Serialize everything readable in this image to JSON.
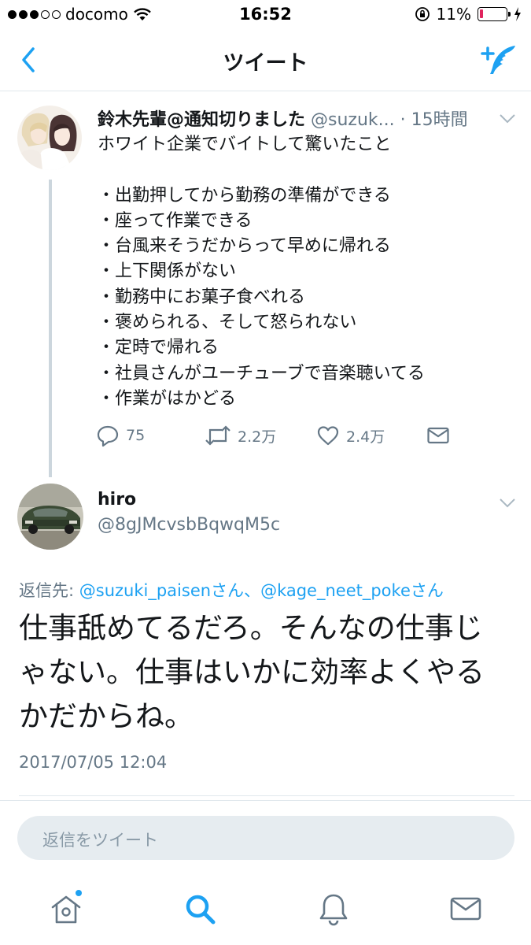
{
  "status_bar": {
    "carrier": "docomo",
    "time": "16:52",
    "battery": "11%",
    "battery_level": 0.11
  },
  "nav": {
    "title": "ツイート"
  },
  "tweet": {
    "display_name": "鈴木先輩@通知切りました",
    "handle": "@suzuk...",
    "time": "· 15時間",
    "lines": [
      "ホワイト企業でバイトして驚いたこと",
      "",
      "・出勤押してから勤務の準備ができる",
      "・座って作業できる",
      "・台風来そうだからって早めに帰れる",
      "・上下関係がない",
      "・勤務中にお菓子食べれる",
      "・褒められる、そして怒られない",
      "・定時で帰れる",
      "・社員さんがユーチューブで音楽聴いてる",
      "・作業がはかどる"
    ],
    "reply_count": "75",
    "retweet_count": "2.2万",
    "like_count": "2.4万"
  },
  "reply": {
    "display_name": "hiro",
    "handle": "@8gJMcvsbBqwqM5c",
    "reply_to_label": "返信先: ",
    "mention_1": "@suzuki_paisenさん",
    "separator": "、",
    "mention_2": "@kage_neet_pokeさん",
    "text_lines": [
      "仕事舐めてるだろ。そんなの仕事じ",
      "ゃない。仕事はいかに効率よくやる",
      "かだからね。"
    ],
    "timestamp": "2017/07/05 12:04"
  },
  "compose_reply": {
    "placeholder": "返信をツイート"
  },
  "colors": {
    "accent": "#1da1f2",
    "secondary_text": "#657786",
    "primary_text": "#14171a",
    "battery_low": "#e0245e"
  },
  "icons": {
    "back": "chevron-left-icon",
    "compose": "compose-tweet-icon",
    "reply": "reply-icon",
    "retweet": "retweet-icon",
    "like": "heart-icon",
    "dm": "envelope-icon",
    "home": "home-icon",
    "search": "search-icon",
    "notifications": "bell-icon",
    "messages": "envelope-icon"
  }
}
